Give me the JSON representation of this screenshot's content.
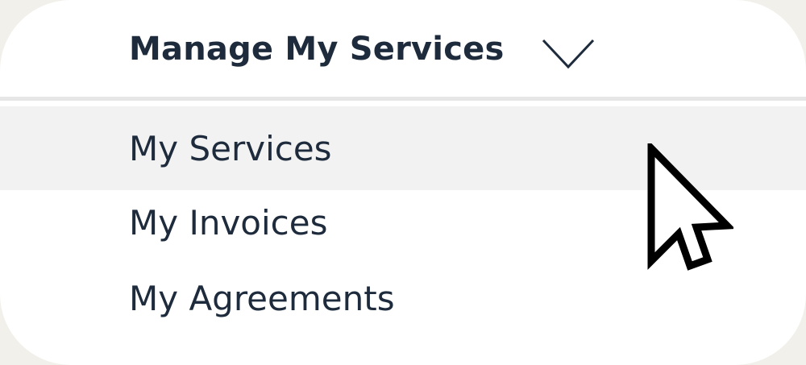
{
  "menu": {
    "title": "Manage My Services",
    "items": [
      {
        "label": "My Services",
        "hovered": true
      },
      {
        "label": "My Invoices",
        "hovered": false
      },
      {
        "label": "My Agreements",
        "hovered": false
      }
    ]
  },
  "icons": {
    "toggle": "chevron-down-icon",
    "pointer": "mouse-pointer-icon"
  },
  "colors": {
    "text": "#1e2b3c",
    "hover_bg": "#f2f2f2",
    "divider": "#e6e6e6",
    "background": "#ffffff"
  }
}
